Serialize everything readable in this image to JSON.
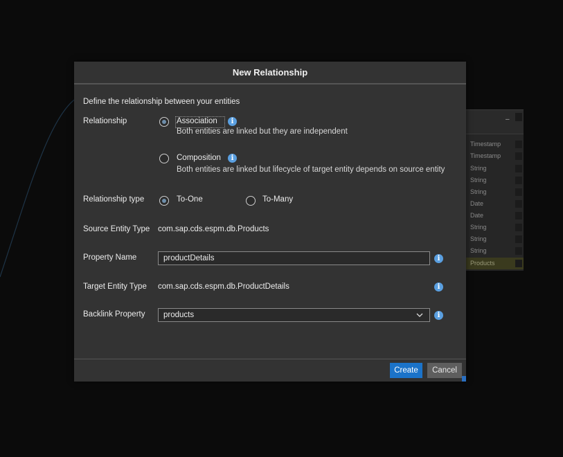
{
  "dialog": {
    "title": "New Relationship",
    "intro": "Define the relationship between your entities",
    "relationship": {
      "label": "Relationship",
      "options": [
        {
          "label": "Association",
          "description": "Both entities are linked but they are independent",
          "selected": true
        },
        {
          "label": "Composition",
          "description": "Both entities are linked but lifecycle of target entity depends on source entity",
          "selected": false
        }
      ]
    },
    "relationship_type": {
      "label": "Relationship type",
      "options": [
        {
          "label": "To-One",
          "selected": true
        },
        {
          "label": "To-Many",
          "selected": false
        }
      ]
    },
    "source_entity_type": {
      "label": "Source Entity Type",
      "value": "com.sap.cds.espm.db.Products"
    },
    "property_name": {
      "label": "Property Name",
      "value": "productDetails"
    },
    "target_entity_type": {
      "label": "Target Entity Type",
      "value": "com.sap.cds.espm.db.ProductDetails"
    },
    "backlink_property": {
      "label": "Backlink Property",
      "value": "products"
    },
    "buttons": {
      "create": "Create",
      "cancel": "Cancel"
    },
    "info_glyph": "i"
  },
  "background_card": {
    "header_dash": "–",
    "rows": [
      "Timestamp",
      "Timestamp",
      "String",
      "String",
      "String",
      "Date",
      "Date",
      "String",
      "String",
      "String",
      "Products"
    ]
  },
  "colors": {
    "accent": "#1b73c9",
    "info": "#5a9fe0",
    "dialog_bg": "#333333",
    "page_bg": "#0b0b0b"
  }
}
